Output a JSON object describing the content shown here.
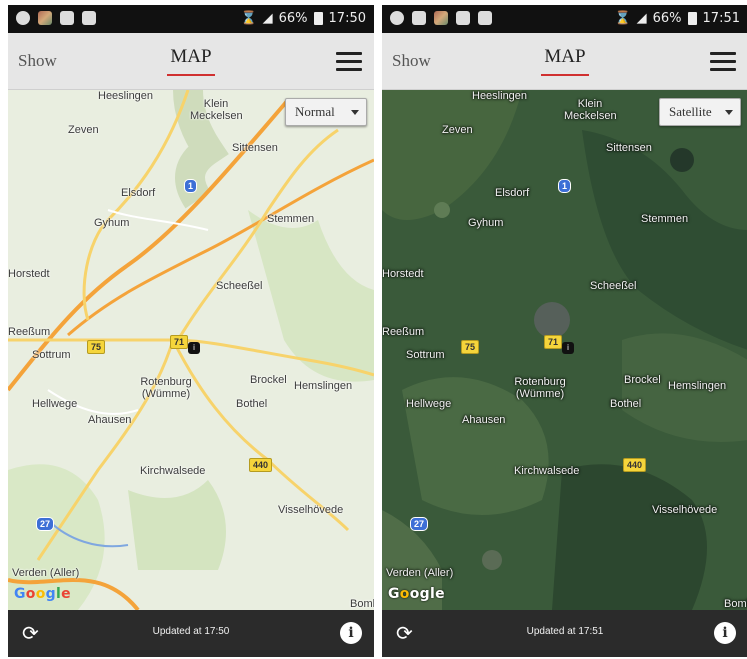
{
  "screens": [
    {
      "status_time": "17:50",
      "battery": "66%",
      "show_label": "Show",
      "title": "MAP",
      "map_type": "Normal",
      "updated": "Updated at 17:50"
    },
    {
      "status_time": "17:51",
      "battery": "66%",
      "show_label": "Show",
      "title": "MAP",
      "map_type": "Satellite",
      "updated": "Updated at 17:51"
    }
  ],
  "map_labels": {
    "heeslingen": "Heeslingen",
    "klein_meckelsen": "Klein Meckelsen",
    "zeven": "Zeven",
    "sittensen": "Sittensen",
    "elsdorf": "Elsdorf",
    "gyhum": "Gyhum",
    "stemmen": "Stemmen",
    "horstedt": "Horstedt",
    "scheessel": "Scheeßel",
    "reeßum": "Reeßum",
    "sottrum": "Sottrum",
    "rotenburg": "Rotenburg (Wümme)",
    "brockel": "Brockel",
    "hemslingen": "Hemslingen",
    "hellwege": "Hellwege",
    "ahausen": "Ahausen",
    "bothel": "Bothel",
    "kirchwalsede": "Kirchwalsede",
    "visselhoevede": "Visselhövede",
    "verden": "Verden (Aller)",
    "bomlitz": "Bomli"
  },
  "road_shields": {
    "a1": "1",
    "b75": "75",
    "b71": "71",
    "b440": "440",
    "a27": "27"
  },
  "google_logo": "Google",
  "colors": {
    "accent": "#d03030",
    "road_major": "#f4a33a",
    "road_minor": "#f7d36b",
    "map_land": "#e9eee0",
    "satellite_land": "#3a5a3a"
  }
}
